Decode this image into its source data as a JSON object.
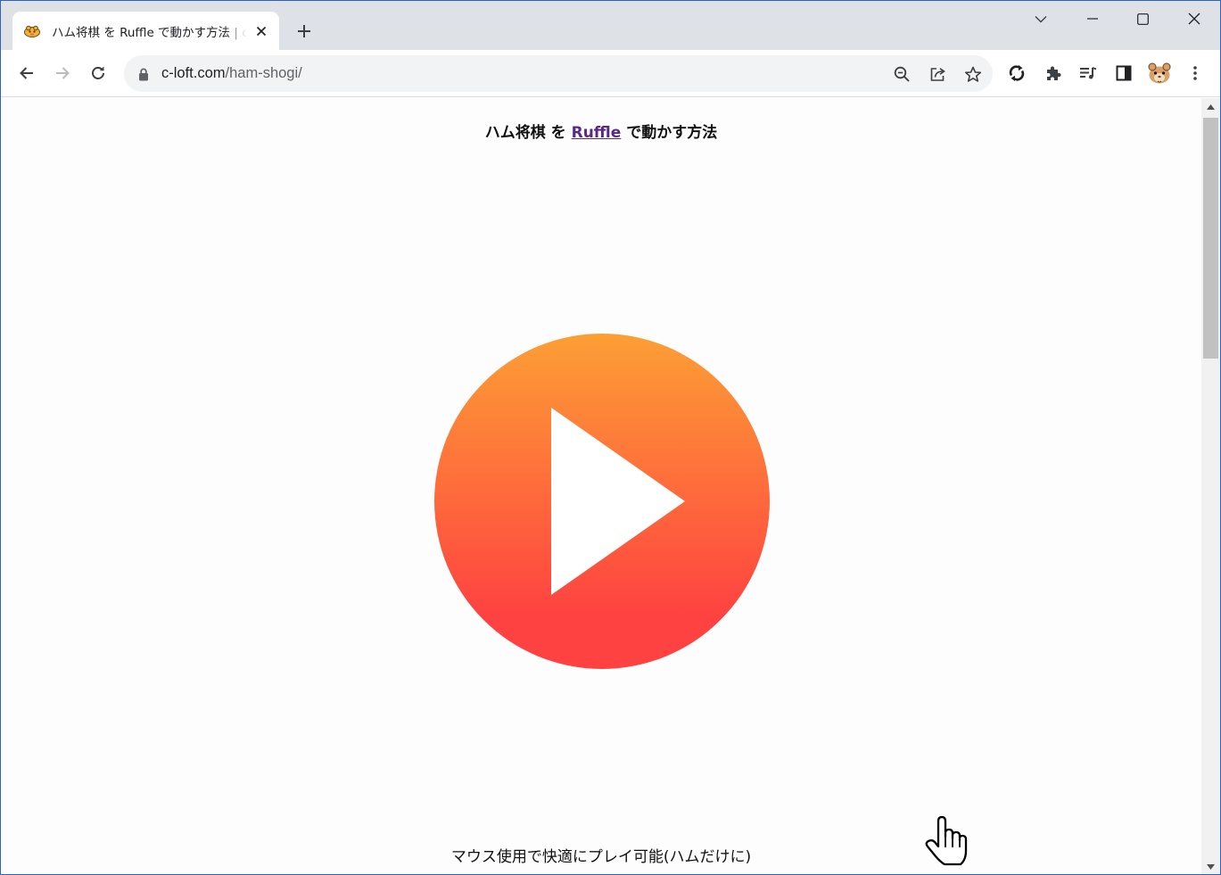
{
  "browser": {
    "tab": {
      "title": "ハム将棋 を Ruffle で動かす方法 | c-loft.com",
      "favicon": "hamster-icon"
    },
    "address_bar": {
      "host": "c-loft.com",
      "path": "/ham-shogi/"
    },
    "toolbar_icons": [
      "back-arrow-icon",
      "forward-arrow-icon",
      "reload-icon",
      "zoom-icon",
      "share-icon",
      "bookmark-star-icon",
      "sync-extension-icon",
      "puzzle-extensions-icon",
      "media-queue-icon",
      "side-panel-icon",
      "profile-avatar",
      "kebab-menu-icon"
    ]
  },
  "page": {
    "heading": {
      "before": "ハム将棋 を ",
      "link": "Ruffle",
      "after": " で動かす方法"
    },
    "caption": "マウス使用で快適にプレイ可能(ハムだけに)"
  },
  "colors": {
    "tab_strip": "#dee1e6",
    "omnibox": "#f1f3f4",
    "play_gradient_top": "#fd9f35",
    "play_gradient_bottom": "#fe4141",
    "link": "#5a2a82"
  }
}
